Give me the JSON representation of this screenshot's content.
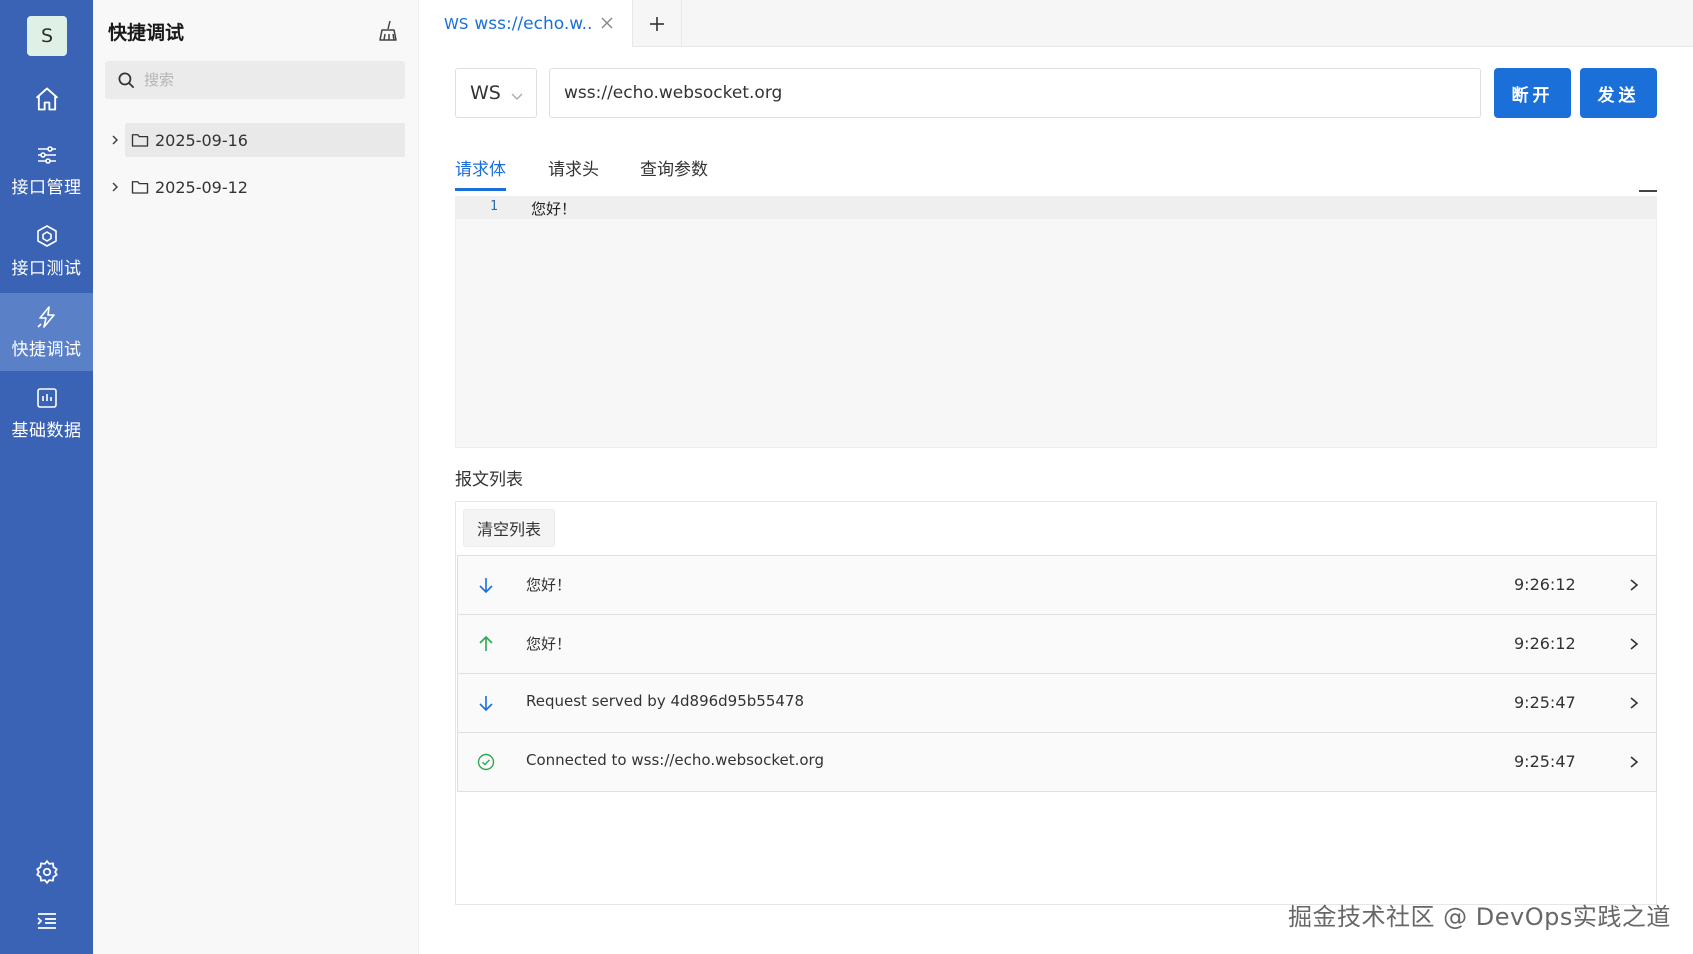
{
  "rail": {
    "avatar_letter": "S",
    "items": [
      {
        "label": "接口管理",
        "icon": "sliders-icon"
      },
      {
        "label": "接口测试",
        "icon": "cube-icon"
      },
      {
        "label": "快捷调试",
        "icon": "flash-icon",
        "active": true
      },
      {
        "label": "基础数据",
        "icon": "chart-box-icon"
      }
    ],
    "accent": "#3a63b5",
    "active_bg": "#5a80c8"
  },
  "side": {
    "title": "快捷调试",
    "search_placeholder": "搜索",
    "tree": [
      {
        "label": "2025-09-16",
        "selected": true
      },
      {
        "label": "2025-09-12",
        "selected": false
      }
    ]
  },
  "tabs": [
    {
      "protocol": "WS",
      "title": "wss://echo.w...",
      "active": true
    }
  ],
  "request": {
    "protocol": "WS",
    "url": "wss://echo.websocket.org",
    "disconnect_label": "断开",
    "send_label": "发送",
    "primary_color": "#1a6fd8"
  },
  "subtabs": [
    {
      "label": "请求体",
      "active": true
    },
    {
      "label": "请求头",
      "active": false
    },
    {
      "label": "查询参数",
      "active": false
    }
  ],
  "editor": {
    "line_number": "1",
    "content": "您好！"
  },
  "messages": {
    "section_label": "报文列表",
    "clear_label": "清空列表",
    "items": [
      {
        "direction": "received",
        "icon": "arrow-down-icon",
        "text": "您好！",
        "time": "9:26:12"
      },
      {
        "direction": "sent",
        "icon": "arrow-up-icon",
        "text": "您好！",
        "time": "9:26:12"
      },
      {
        "direction": "received",
        "icon": "arrow-down-icon",
        "text": "Request served by 4d896d95b55478",
        "time": "9:25:47"
      },
      {
        "direction": "status",
        "icon": "check-circle-icon",
        "text": "Connected to wss://echo.websocket.org",
        "time": "9:25:47"
      }
    ]
  },
  "watermark": "掘金技术社区 @ DevOps实践之道"
}
